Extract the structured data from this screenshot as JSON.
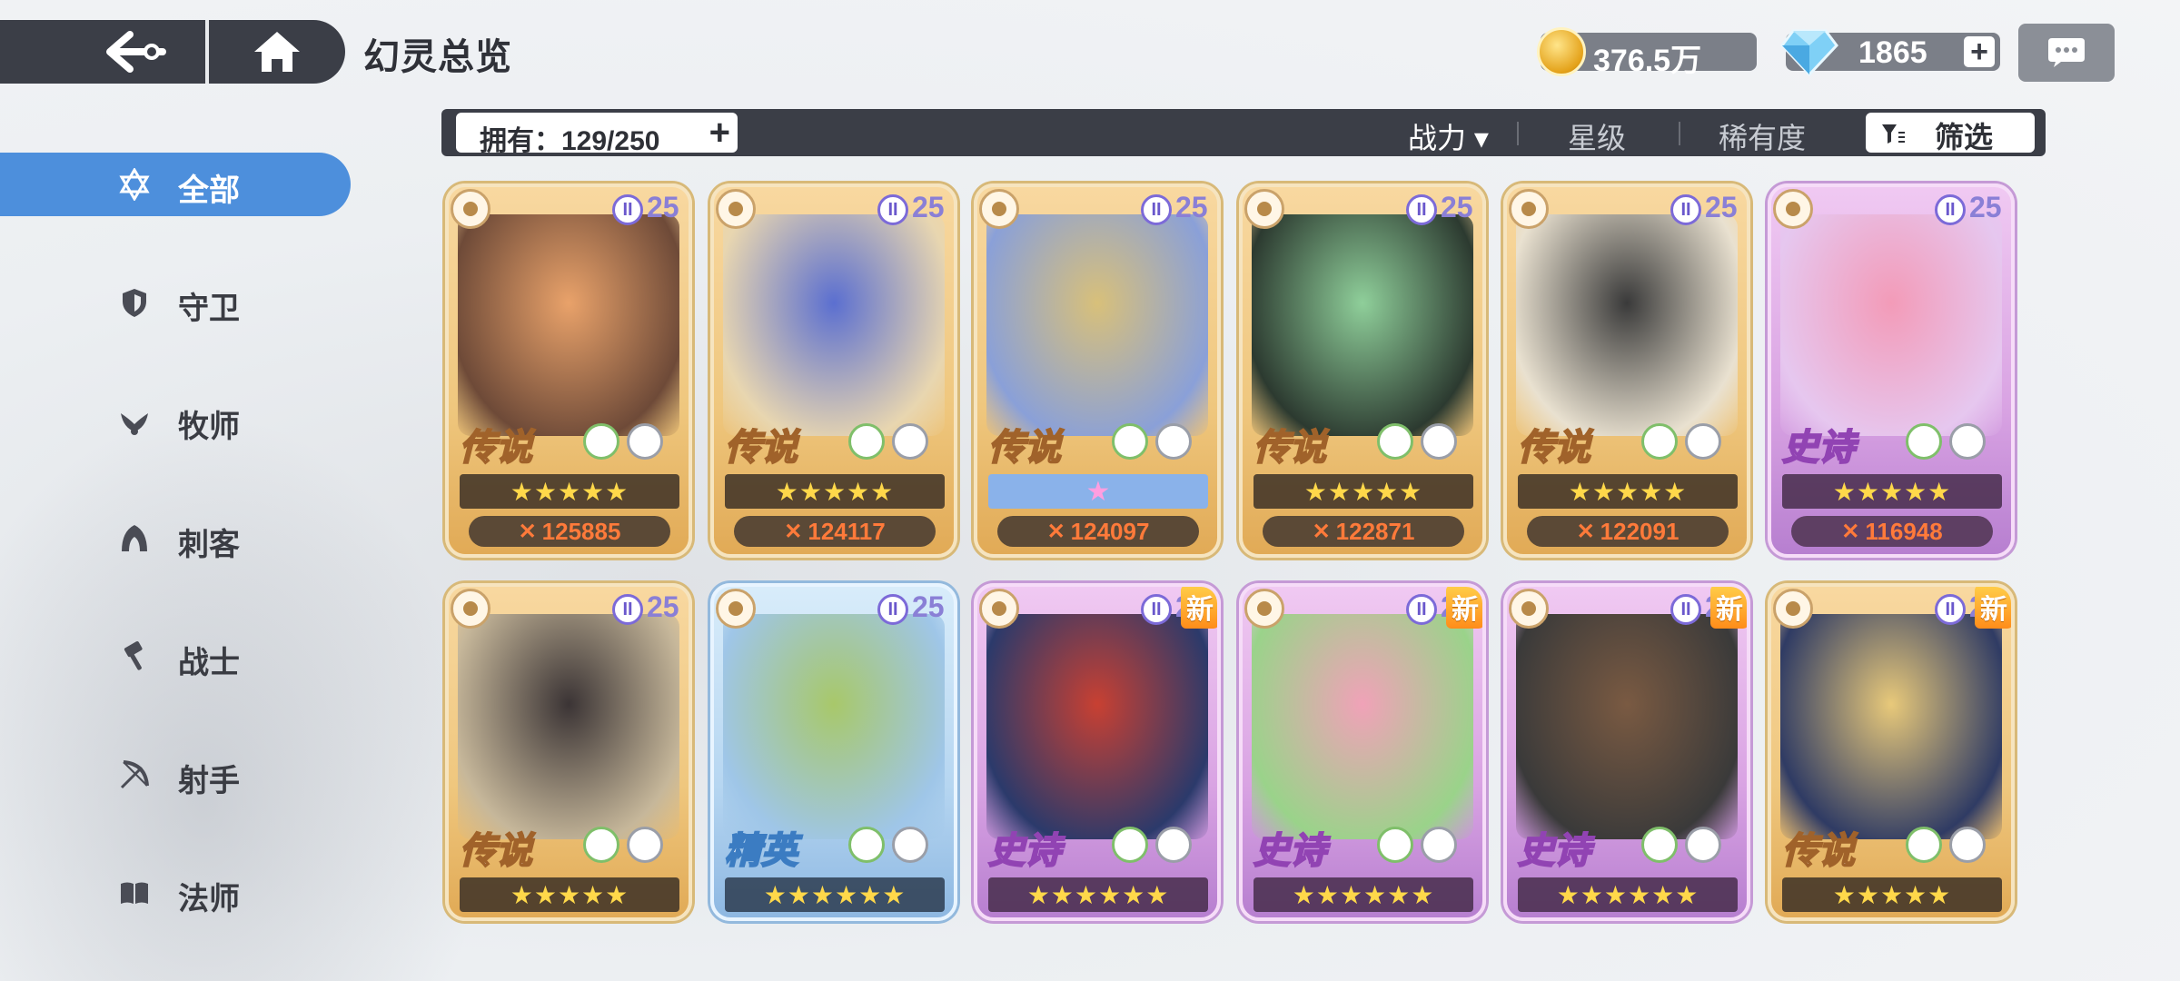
{
  "header": {
    "title": "幻灵总览",
    "gold": "376.5万",
    "gems": "1865",
    "plus": "+"
  },
  "sidebar": {
    "items": [
      {
        "label": "全部",
        "icon": "star-of-david-icon",
        "active": true
      },
      {
        "label": "守卫",
        "icon": "shield-icon",
        "active": false
      },
      {
        "label": "牧师",
        "icon": "wing-icon",
        "active": false
      },
      {
        "label": "刺客",
        "icon": "hood-icon",
        "active": false
      },
      {
        "label": "战士",
        "icon": "hammer-icon",
        "active": false
      },
      {
        "label": "射手",
        "icon": "bow-icon",
        "active": false
      },
      {
        "label": "法师",
        "icon": "book-icon",
        "active": false
      }
    ]
  },
  "toolbar": {
    "owned": "拥有：129/250",
    "owned_plus": "+",
    "sort_power": "战力 ▾",
    "sort_star": "星级",
    "sort_rarity": "稀有度",
    "filter": "筛选"
  },
  "cards": [
    {
      "rarity": "传说",
      "level": "25",
      "stars": "★★★★★",
      "power": "125885",
      "new": "",
      "class": "legend",
      "colors": [
        "#e9a26a",
        "#6e4a38"
      ]
    },
    {
      "rarity": "传说",
      "level": "25",
      "stars": "★★★★★",
      "power": "124117",
      "new": "",
      "class": "legend",
      "colors": [
        "#5b6fd0",
        "#e8d6b0"
      ]
    },
    {
      "rarity": "传说",
      "level": "25",
      "stars": "★",
      "power": "124097",
      "new": "",
      "class": "legend",
      "colors": [
        "#d8c07a",
        "#8aa0d8"
      ]
    },
    {
      "rarity": "传说",
      "level": "25",
      "stars": "★★★★★",
      "power": "122871",
      "new": "",
      "class": "legend",
      "colors": [
        "#8fcf9a",
        "#2c3a30"
      ]
    },
    {
      "rarity": "传说",
      "level": "25",
      "stars": "★★★★★",
      "power": "122091",
      "new": "",
      "class": "legend",
      "colors": [
        "#3a3a3a",
        "#e9e1d0"
      ]
    },
    {
      "rarity": "史诗",
      "level": "25",
      "stars": "★★★★★",
      "power": "116948",
      "new": "",
      "class": "epic",
      "colors": [
        "#f39bb8",
        "#e6c7ef"
      ]
    },
    {
      "rarity": "传说",
      "level": "25",
      "stars": "★★★★★",
      "power": "",
      "new": "",
      "class": "legend",
      "colors": [
        "#3b3435",
        "#c6b79a"
      ]
    },
    {
      "rarity": "精英",
      "level": "25",
      "stars": "★★★★★★",
      "power": "",
      "new": "",
      "class": "elite",
      "colors": [
        "#a8c86a",
        "#9fc6e8"
      ]
    },
    {
      "rarity": "史诗",
      "level": "25",
      "stars": "★★★★★★",
      "power": "",
      "new": "新",
      "class": "epic",
      "colors": [
        "#c84032",
        "#2b3a6b"
      ]
    },
    {
      "rarity": "史诗",
      "level": "25",
      "stars": "★★★★★★",
      "power": "",
      "new": "新",
      "class": "epic",
      "colors": [
        "#f0a2b8",
        "#9ad38a"
      ]
    },
    {
      "rarity": "史诗",
      "level": "25",
      "stars": "★★★★★★",
      "power": "",
      "new": "新",
      "class": "epic",
      "colors": [
        "#7a5a42",
        "#3a3a3a"
      ]
    },
    {
      "rarity": "传说",
      "level": "25",
      "stars": "★★★★★",
      "power": "",
      "new": "新",
      "class": "legend",
      "colors": [
        "#e8c97a",
        "#2f3b64"
      ]
    }
  ]
}
